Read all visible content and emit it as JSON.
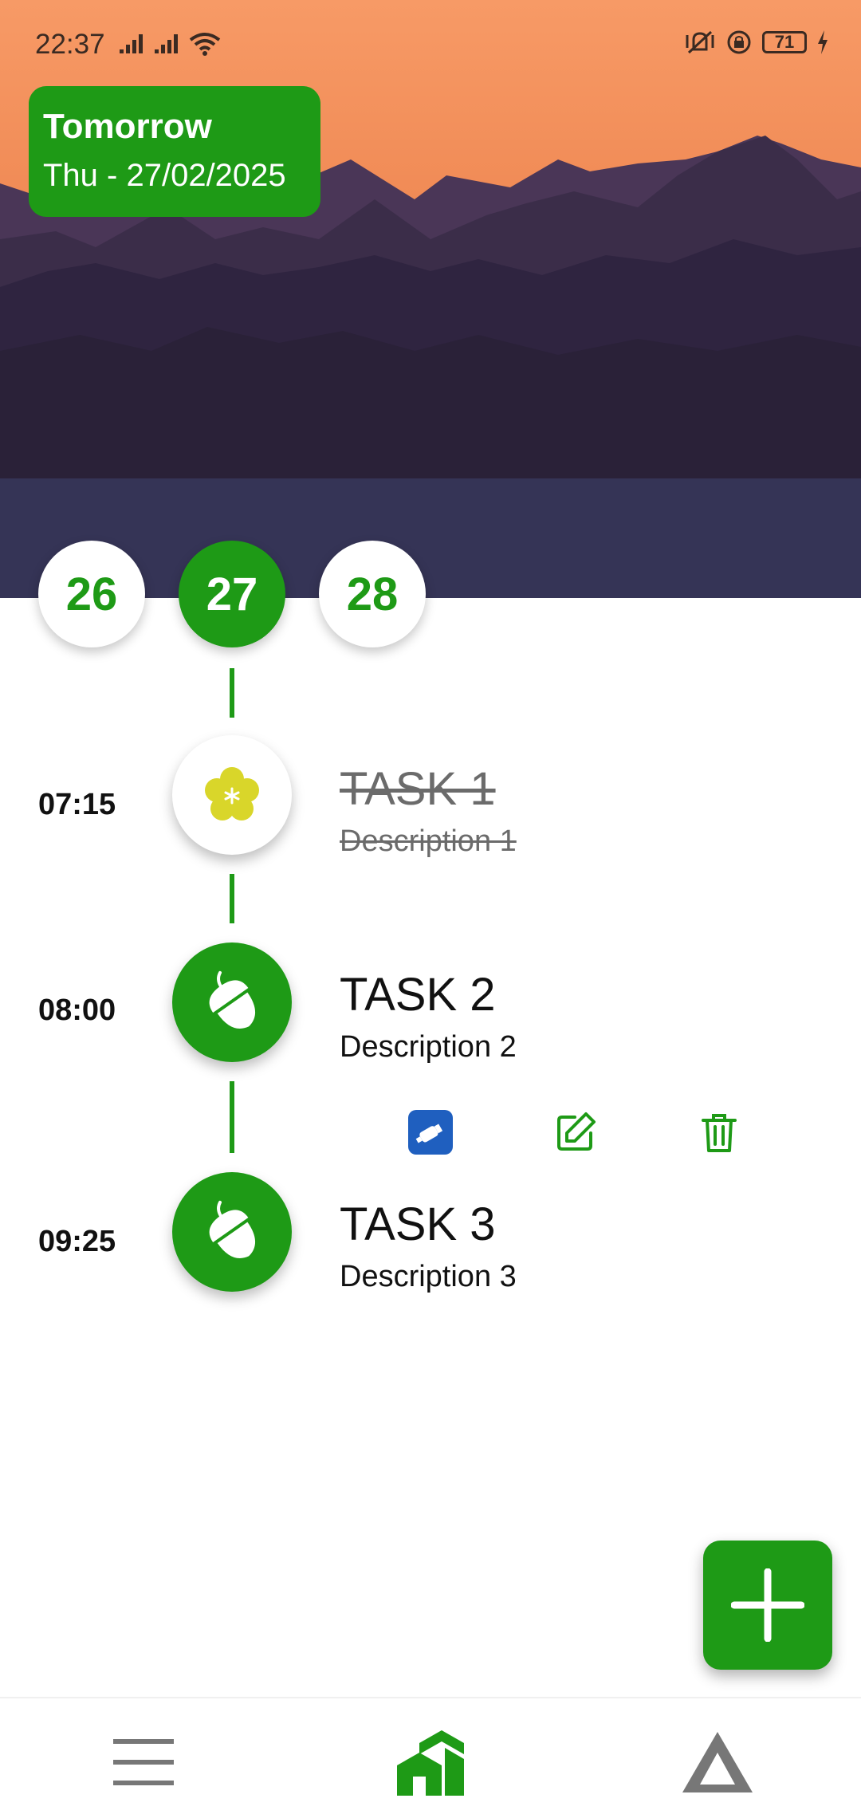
{
  "status_bar": {
    "time": "22:37",
    "battery": "71"
  },
  "header": {
    "title": "Tomorrow",
    "date": "Thu - 27/02/2025"
  },
  "days": [
    {
      "label": "26",
      "active": false
    },
    {
      "label": "27",
      "active": true
    },
    {
      "label": "28",
      "active": false
    }
  ],
  "tasks": [
    {
      "time": "07:15",
      "title": "TASK 1",
      "description": "Description 1",
      "completed": true,
      "icon": "flower-icon"
    },
    {
      "time": "08:00",
      "title": "TASK 2",
      "description": "Description 2",
      "completed": false,
      "icon": "acorn-icon"
    },
    {
      "time": "09:25",
      "title": "TASK 3",
      "description": "Description 3",
      "completed": false,
      "icon": "acorn-icon"
    }
  ],
  "task_actions": [
    "link-icon",
    "edit-icon",
    "trash-icon"
  ],
  "fab": {
    "icon": "plus-icon"
  },
  "bottom_nav": [
    "menu-icon",
    "home-icon",
    "triangle-icon"
  ],
  "colors": {
    "accent": "#1e9a16",
    "completed_text": "#6b6b6b",
    "flower": "#d9d62a",
    "link_button": "#1f5fbf"
  }
}
